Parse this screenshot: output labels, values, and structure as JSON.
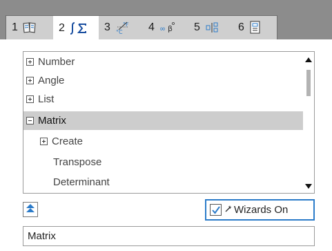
{
  "tabs": [
    {
      "number": "1",
      "icon": "book-icon",
      "active": false
    },
    {
      "number": "2",
      "icon": "integral-sigma-icon",
      "active": true
    },
    {
      "number": "3",
      "icon": "unit-conversion-icon",
      "active": false
    },
    {
      "number": "4",
      "icon": "infinity-beta-icon",
      "active": false
    },
    {
      "number": "5",
      "icon": "error-bracket-icon",
      "active": false
    },
    {
      "number": "6",
      "icon": "document-icon",
      "active": false
    }
  ],
  "tree": [
    {
      "label": "Number",
      "expander": "plus",
      "indent": 0,
      "selected": false
    },
    {
      "label": "Angle",
      "expander": "plus",
      "indent": 0,
      "selected": false
    },
    {
      "label": "List",
      "expander": "plus",
      "indent": 0,
      "selected": false
    },
    {
      "label": "Matrix",
      "expander": "minus",
      "indent": 0,
      "selected": true
    },
    {
      "label": "Create",
      "expander": "plus",
      "indent": 1,
      "selected": false
    },
    {
      "label": "Transpose",
      "expander": "none",
      "indent": 1,
      "selected": false
    },
    {
      "label": "Determinant",
      "expander": "none",
      "indent": 1,
      "selected": false
    }
  ],
  "wizards": {
    "label": "Wizards On",
    "checked": true
  },
  "status": {
    "text": "Matrix"
  },
  "colors": {
    "accent": "#2b7bc9",
    "selection": "#cdcdcd",
    "tab_bar": "#8c8c8c"
  }
}
